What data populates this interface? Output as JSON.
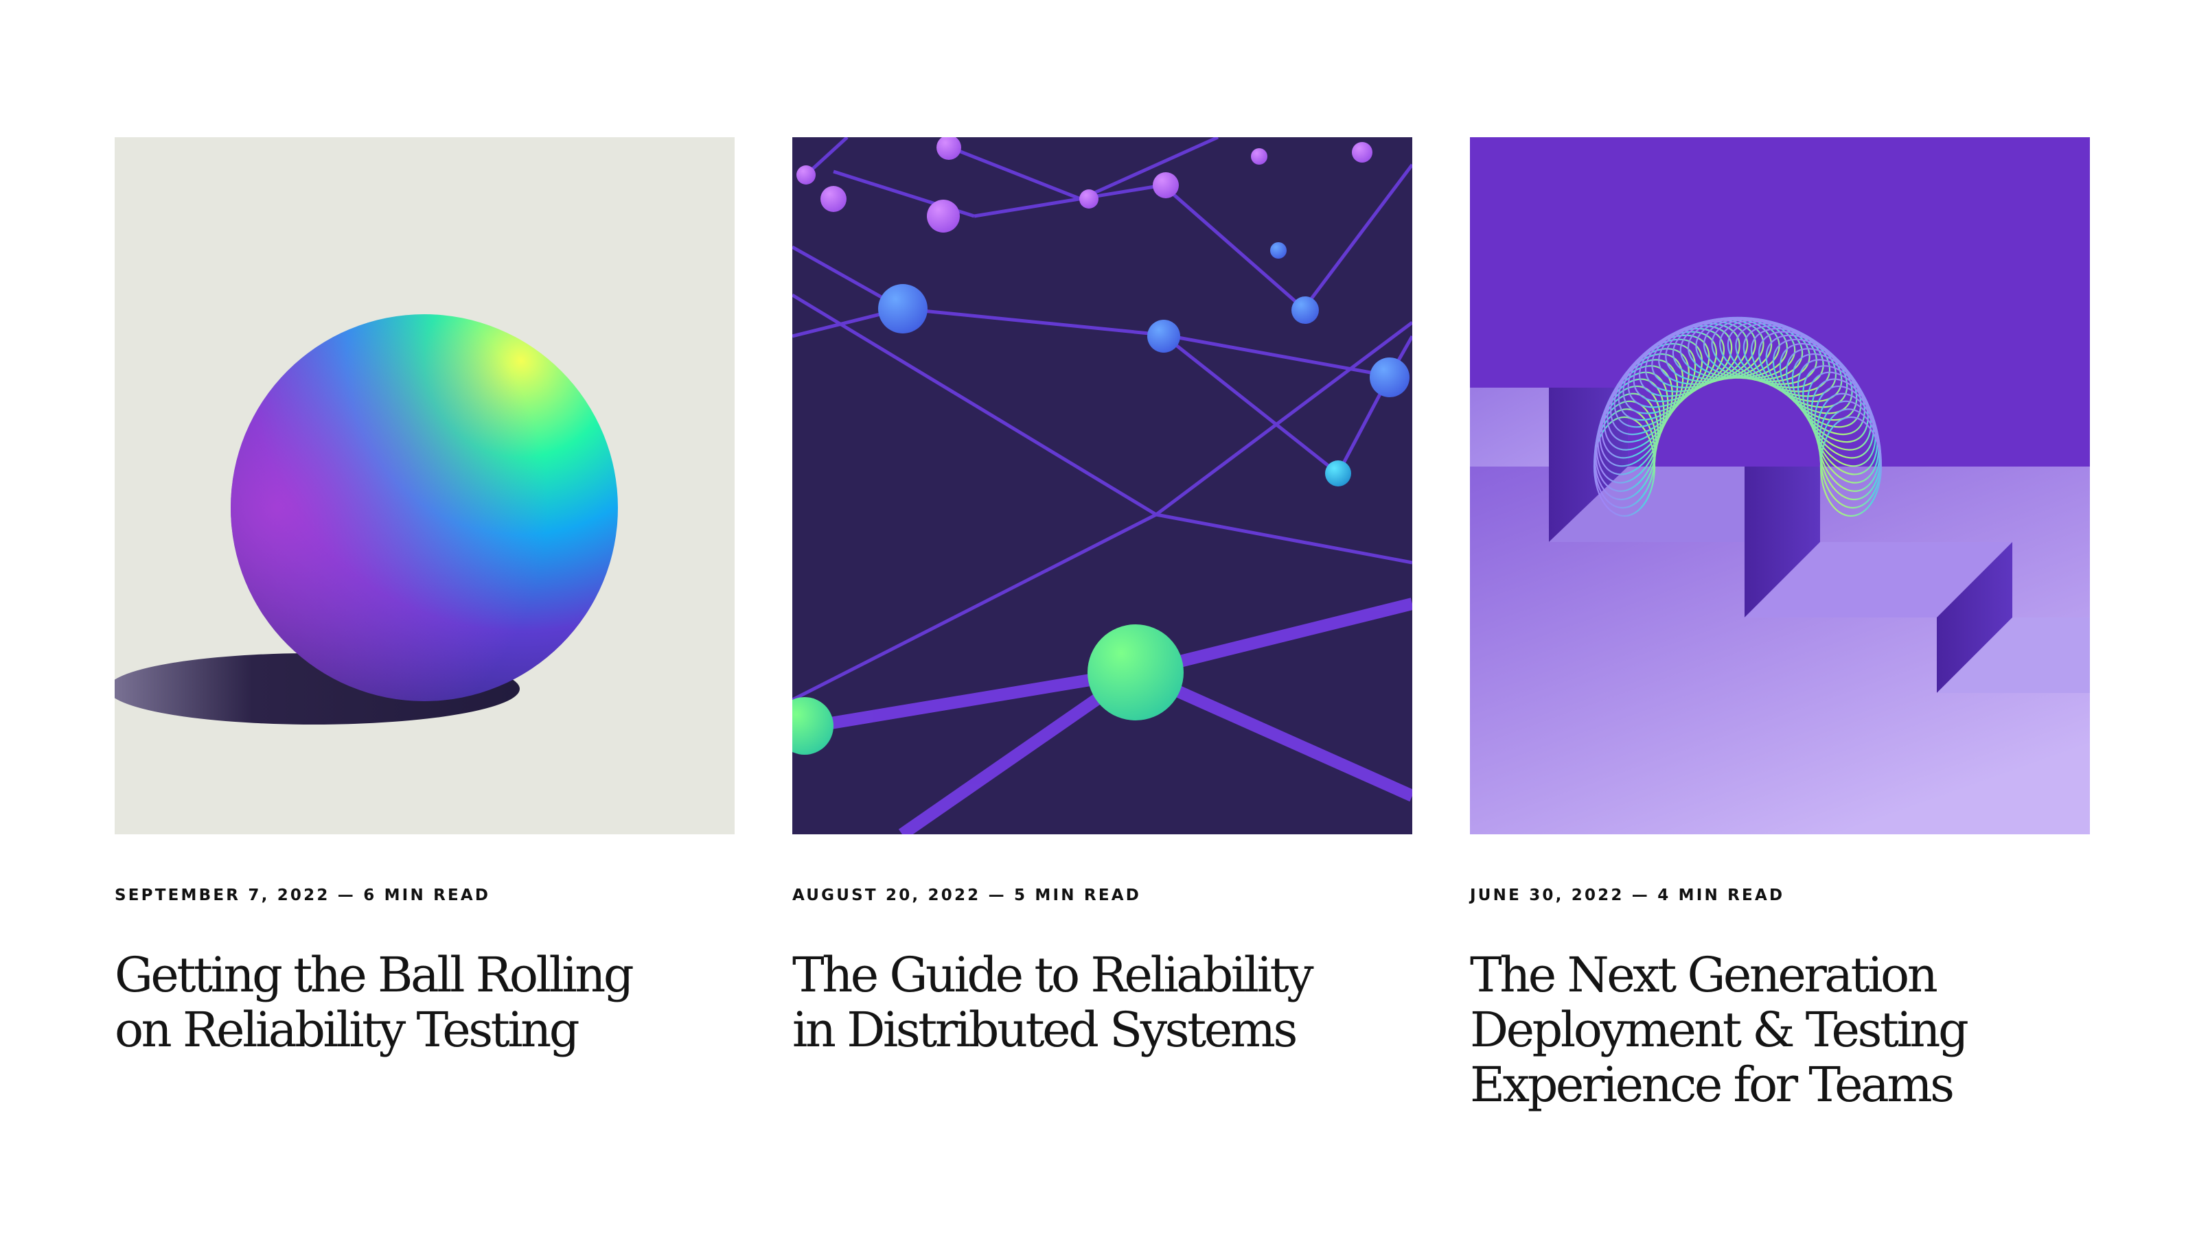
{
  "articles": [
    {
      "date": "SEPTEMBER 7, 2022",
      "separator": "—",
      "read_time": "6 MIN READ",
      "title_lines": [
        "Getting the Ball Rolling",
        "on Reliability Testing"
      ],
      "image": "gradient-sphere-illustration"
    },
    {
      "date": "AUGUST 20, 2022",
      "separator": "—",
      "read_time": "5 MIN READ",
      "title_lines": [
        "The Guide to Reliability",
        "in Distributed Systems"
      ],
      "image": "network-nodes-illustration"
    },
    {
      "date": "JUNE 30, 2022",
      "separator": "—",
      "read_time": "4 MIN READ",
      "title_lines": [
        "The Next Generation",
        "Deployment & Testing",
        "Experience for Teams"
      ],
      "image": "spring-on-stairs-illustration"
    }
  ],
  "colors": {
    "background": "#ffffff",
    "card1_bg": "#e6e7df",
    "card2_bg": "#2d2256",
    "card3_bg": "#6a31c9",
    "text": "#141414"
  }
}
